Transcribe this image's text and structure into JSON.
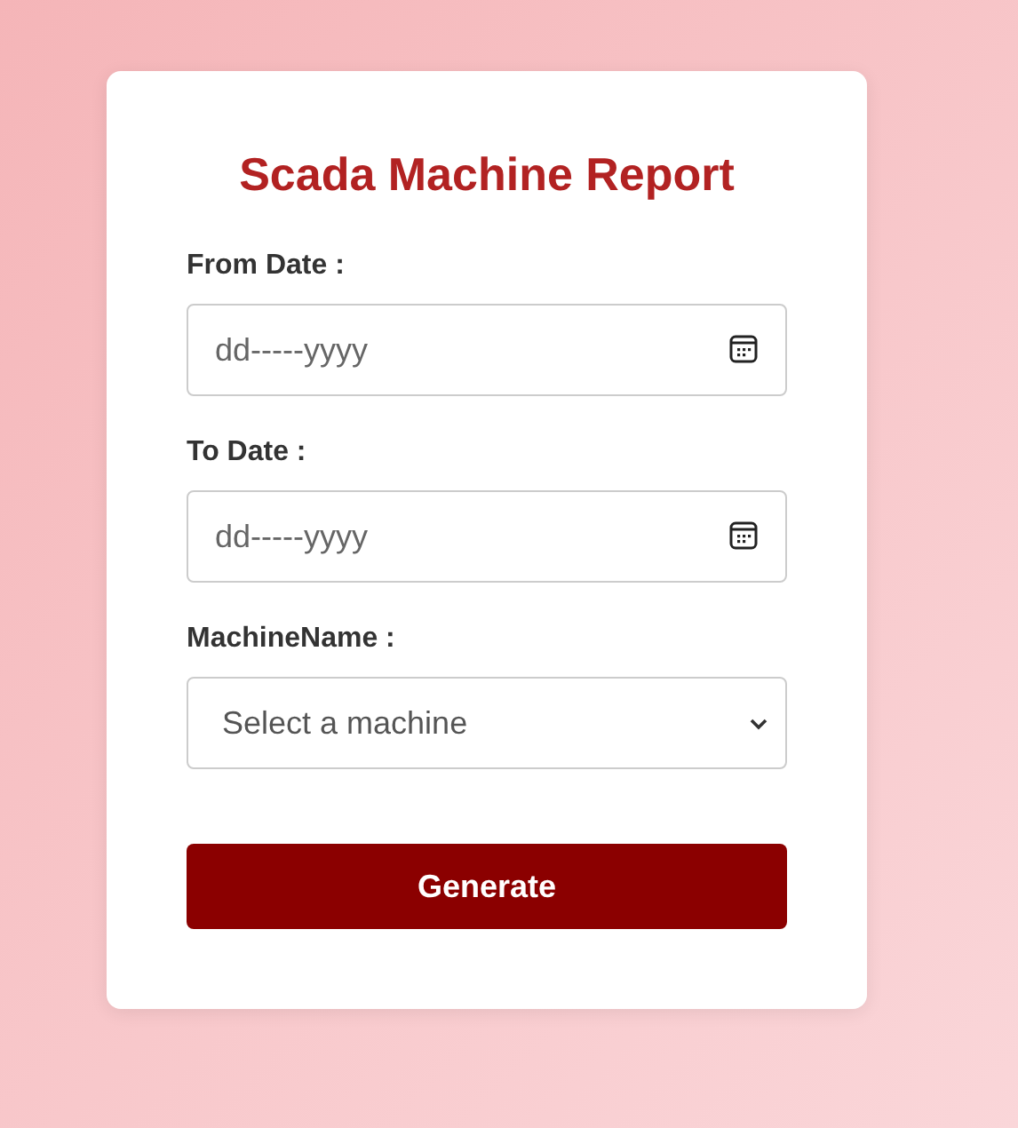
{
  "form": {
    "title": "Scada Machine Report",
    "fields": [
      {
        "kind": "date",
        "label": "From Date :",
        "placeholder": "dd-----yyyy"
      },
      {
        "kind": "date",
        "label": "To Date :",
        "placeholder": "dd-----yyyy"
      },
      {
        "kind": "select",
        "label": "MachineName :",
        "placeholder": "Select a machine"
      }
    ],
    "button": "Generate"
  }
}
